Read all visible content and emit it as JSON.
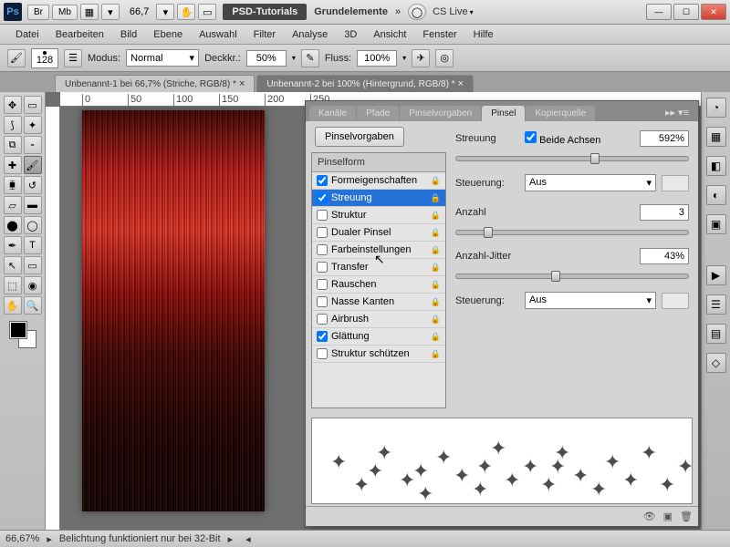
{
  "titlebar": {
    "ps": "Ps",
    "br": "Br",
    "mb": "Mb",
    "zoom": "66,7",
    "psd_tut": "PSD-Tutorials",
    "grund": "Grundelemente",
    "cslive": "CS Live"
  },
  "menu": [
    "Datei",
    "Bearbeiten",
    "Bild",
    "Ebene",
    "Auswahl",
    "Filter",
    "Analyse",
    "3D",
    "Ansicht",
    "Fenster",
    "Hilfe"
  ],
  "optbar": {
    "brush_size": "128",
    "modus_label": "Modus:",
    "modus_value": "Normal",
    "deck_label": "Deckkr.:",
    "deck_value": "50%",
    "fluss_label": "Fluss:",
    "fluss_value": "100%"
  },
  "doc_tabs": [
    {
      "label": "Unbenannt-1 bei 66,7% (Striche, RGB/8) *",
      "active": false
    },
    {
      "label": "Unbenannt-2 bei 100% (Hintergrund, RGB/8) *",
      "active": true
    }
  ],
  "ruler_marks": [
    "0",
    "50",
    "100",
    "150",
    "200",
    "250"
  ],
  "panel": {
    "tabs": [
      "Kanäle",
      "Pfade",
      "Pinselvorgaben",
      "Pinsel",
      "Kopierquelle"
    ],
    "active_tab": "Pinsel",
    "preset_btn": "Pinselvorgaben",
    "list_header": "Pinselform",
    "options": [
      {
        "label": "Formeigenschaften",
        "checked": true,
        "selected": false
      },
      {
        "label": "Streuung",
        "checked": true,
        "selected": true
      },
      {
        "label": "Struktur",
        "checked": false,
        "selected": false
      },
      {
        "label": "Dualer Pinsel",
        "checked": false,
        "selected": false
      },
      {
        "label": "Farbeinstellungen",
        "checked": false,
        "selected": false
      },
      {
        "label": "Transfer",
        "checked": false,
        "selected": false
      },
      {
        "label": "Rauschen",
        "checked": false,
        "selected": false
      },
      {
        "label": "Nasse Kanten",
        "checked": false,
        "selected": false
      },
      {
        "label": "Airbrush",
        "checked": false,
        "selected": false
      },
      {
        "label": "Glättung",
        "checked": true,
        "selected": false
      },
      {
        "label": "Struktur schützen",
        "checked": false,
        "selected": false
      }
    ],
    "ctrl": {
      "streuung_label": "Streuung",
      "beide_achsen": "Beide Achsen",
      "streuung_value": "592%",
      "steuerung_label": "Steuerung:",
      "steuerung_value": "Aus",
      "anzahl_label": "Anzahl",
      "anzahl_value": "3",
      "jitter_label": "Anzahl-Jitter",
      "jitter_value": "43%"
    }
  },
  "status": {
    "zoom": "66,67%",
    "msg": "Belichtung funktioniert nur bei 32-Bit"
  }
}
